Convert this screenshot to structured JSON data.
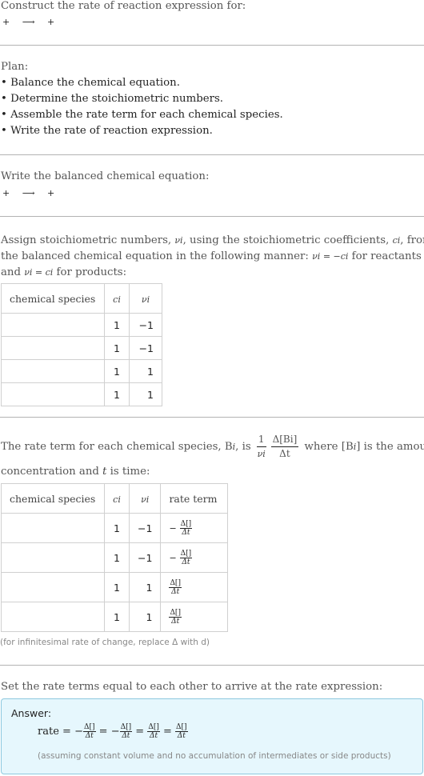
{
  "intro": {
    "heading": "Construct the rate of reaction expression for:",
    "equation": [
      "+",
      "⟶",
      "+"
    ]
  },
  "plan": {
    "heading": "Plan:",
    "steps": [
      "• Balance the chemical equation.",
      "• Determine the stoichiometric numbers.",
      "• Assemble the rate term for each chemical species.",
      "• Write the rate of reaction expression."
    ]
  },
  "balanced": {
    "heading": "Write the balanced chemical equation:",
    "equation": [
      "+",
      "⟶",
      "+"
    ]
  },
  "stoich": {
    "line1": "Assign stoichiometric numbers, ",
    "nu_i": "νi",
    "line1b": ", using the stoichiometric coefficients, ",
    "c_i": "ci",
    "line1c": ", from",
    "line2": "the balanced chemical equation in the following manner: ",
    "line2_math": "νi = −ci",
    "line2b": " for reactants",
    "line3a": "and ",
    "line3_math": "νi = ci",
    "line3b": " for products:",
    "table": {
      "headers": [
        "chemical species",
        "ci",
        "νi"
      ],
      "rows": [
        {
          "species": "",
          "c": "1",
          "nu": "−1"
        },
        {
          "species": "",
          "c": "1",
          "nu": "−1"
        },
        {
          "species": "",
          "c": "1",
          "nu": "1"
        },
        {
          "species": "",
          "c": "1",
          "nu": "1"
        }
      ]
    }
  },
  "rate_terms": {
    "line1a": "The rate term for each chemical species, B",
    "line1_sub": "i",
    "line1b": ", is",
    "frac1_num": "1",
    "frac1_den": "νi",
    "frac2_num": "Δ[Bi]",
    "frac2_den": "Δt",
    "line1c": "where [B",
    "line1d": "] is the amount",
    "line2a": "concentration and ",
    "line2_t": "t",
    "line2b": " is time:",
    "table": {
      "headers": [
        "chemical species",
        "ci",
        "νi",
        "rate term"
      ],
      "rows": [
        {
          "species": "",
          "c": "1",
          "nu": "−1",
          "sign": "−",
          "num": "Δ[]",
          "den": "Δt"
        },
        {
          "species": "",
          "c": "1",
          "nu": "−1",
          "sign": "−",
          "num": "Δ[]",
          "den": "Δt"
        },
        {
          "species": "",
          "c": "1",
          "nu": "1",
          "sign": "",
          "num": "Δ[]",
          "den": "Δt"
        },
        {
          "species": "",
          "c": "1",
          "nu": "1",
          "sign": "",
          "num": "Δ[]",
          "den": "Δt"
        }
      ]
    },
    "note": "(for infinitesimal rate of change, replace Δ with d)"
  },
  "final": {
    "heading": "Set the rate terms equal to each other to arrive at the rate expression:",
    "answer_label": "Answer:",
    "rate_label": "rate",
    "equals": "=",
    "terms": [
      {
        "sign": "−",
        "num": "Δ[]",
        "den": "Δt"
      },
      {
        "sign": "−",
        "num": "Δ[]",
        "den": "Δt"
      },
      {
        "sign": "",
        "num": "Δ[]",
        "den": "Δt"
      },
      {
        "sign": "",
        "num": "Δ[]",
        "den": "Δt"
      }
    ],
    "assumption": "(assuming constant volume and no accumulation of intermediates or side products)"
  },
  "colors": {
    "answer_bg": "#e6f7fd",
    "answer_border": "#8ec9df",
    "divider": "#b3b3b3"
  }
}
